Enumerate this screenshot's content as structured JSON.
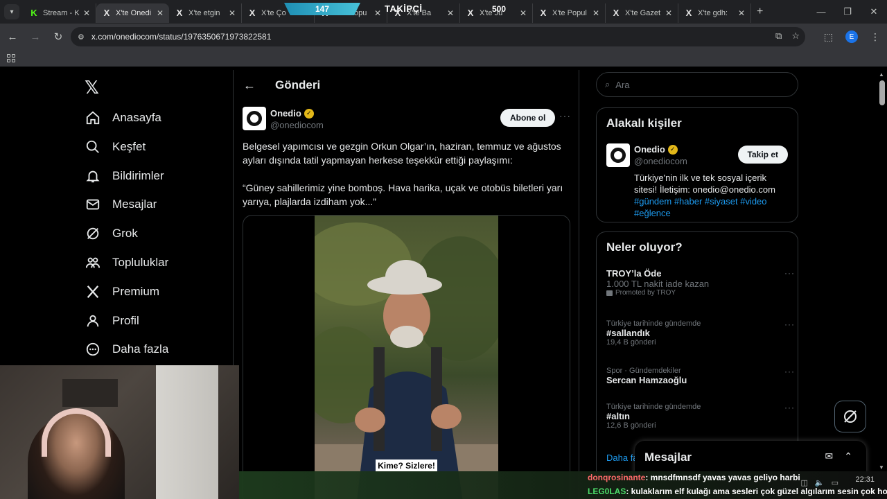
{
  "browser": {
    "tabs": [
      {
        "title": "Stream - K",
        "favicon": "kick-icon",
        "active": false
      },
      {
        "title": "X'te Onedi",
        "favicon": "x-icon",
        "active": true
      },
      {
        "title": "X'te etgin",
        "favicon": "x-icon",
        "active": false
      },
      {
        "title": "X'te Ço",
        "favicon": "x-icon",
        "active": false
      },
      {
        "title": "X'te Popu",
        "favicon": "x-icon",
        "active": false
      },
      {
        "title": "X'te Ba",
        "favicon": "x-icon",
        "active": false
      },
      {
        "title": "X'te Ju",
        "favicon": "x-icon",
        "active": false
      },
      {
        "title": "X'te Popul",
        "favicon": "x-icon",
        "active": false
      },
      {
        "title": "X'te Gazet",
        "favicon": "x-icon",
        "active": false
      },
      {
        "title": "X'te gdh: ",
        "favicon": "x-icon",
        "active": false
      }
    ],
    "url": "x.com/onediocom/status/1976350671973822581",
    "profile_initial": "E"
  },
  "overlay": {
    "left_number": "147",
    "label": "TAKİPÇİ",
    "right_number": "500"
  },
  "leftnav": {
    "items": [
      {
        "label": "Anasayfa",
        "icon": "home-icon"
      },
      {
        "label": "Keşfet",
        "icon": "search-icon"
      },
      {
        "label": "Bildirimler",
        "icon": "bell-icon"
      },
      {
        "label": "Mesajlar",
        "icon": "mail-icon"
      },
      {
        "label": "Grok",
        "icon": "grok-icon"
      },
      {
        "label": "Topluluklar",
        "icon": "communities-icon"
      },
      {
        "label": "Premium",
        "icon": "x-icon"
      },
      {
        "label": "Profil",
        "icon": "person-icon"
      },
      {
        "label": "Daha fazla",
        "icon": "more-circle-icon"
      }
    ]
  },
  "post": {
    "header_title": "Gönderi",
    "author_name": "Onedio",
    "author_handle": "@onediocom",
    "subscribe_label": "Abone ol",
    "text_p1": "Belgesel yapımcısı ve gezgin Orkun Olgar’ın, haziran, temmuz ve ağustos ayları dışında tatil yapmayan herkese teşekkür ettiği paylaşımı:",
    "text_p2": "“Güney sahillerimiz yine bomboş. Hava harika, uçak ve otobüs biletleri yarı yarıya, plajlarda izdiham yok...”",
    "video_caption": "Kime? Sizlere!"
  },
  "right": {
    "search_placeholder": "Ara",
    "related": {
      "title": "Alakalı kişiler",
      "name": "Onedio",
      "handle": "@onediocom",
      "follow_label": "Takip et",
      "bio": "Türkiye'nin ilk ve tek sosyal içerik sitesi! İletişim: onedio@onedio.com",
      "hashtags": "#gündem #haber #siyaset #video #eğlence"
    },
    "trends": {
      "title": "Neler oluyor?",
      "promo_name": "TROY’la Öde",
      "promo_sub": "1.000 TL nakit iade kazan",
      "promo_by": "Promoted by TROY",
      "items": [
        {
          "context": "Türkiye tarihinde gündemde",
          "name": "#sallandık",
          "count": "19,4 B gönderi"
        },
        {
          "context": "Spor · Gündemdekiler",
          "name": "Sercan Hamzaoğlu",
          "count": ""
        },
        {
          "context": "Türkiye tarihinde gündemde",
          "name": "#altın",
          "count": "12,6 B gönderi"
        }
      ],
      "more_link": "Daha fa"
    },
    "messages_title": "Mesajlar"
  },
  "chat": {
    "line1_user": "donqrosinante",
    "line1_msg": ": mnsdfmnsdf yavas yavas geliyo harbi",
    "line2_user": "LEG0LAS",
    "line2_msg": ": kulaklarım elf kulağı ama sesleri çok güzel algılarım sesin çok hoş"
  },
  "taskbar": {
    "time": "22:31"
  }
}
